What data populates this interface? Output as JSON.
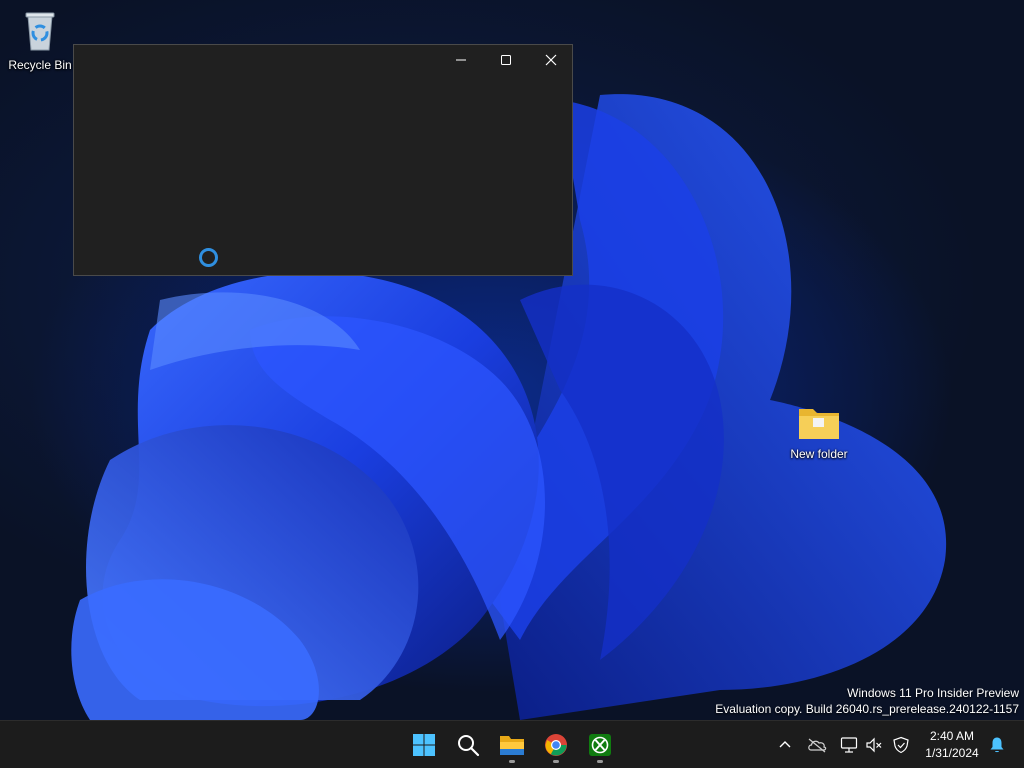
{
  "desktop": {
    "icons": [
      {
        "label": "Recycle Bin"
      },
      {
        "label": "New folder"
      }
    ],
    "watermark": {
      "line1": "Windows 11 Pro Insider Preview",
      "line2": "Evaluation copy. Build 26040.rs_prerelease.240122-1157"
    }
  },
  "window": {
    "controls": [
      "minimize-icon",
      "maximize-icon",
      "close-icon"
    ],
    "state": "loading"
  },
  "taskbar": {
    "apps": [
      "start",
      "search",
      "file-explorer",
      "chrome",
      "xbox"
    ],
    "tray_icons": [
      "chevron-up-icon",
      "onedrive-icon",
      "network-icon",
      "volume-muted-icon",
      "security-icon"
    ],
    "clock": {
      "time": "2:40 AM",
      "date": "1/31/2024"
    }
  },
  "colors": {
    "accent": "#2f8fe0",
    "taskbar": "#1c1c1c",
    "window_bg": "#202020"
  }
}
